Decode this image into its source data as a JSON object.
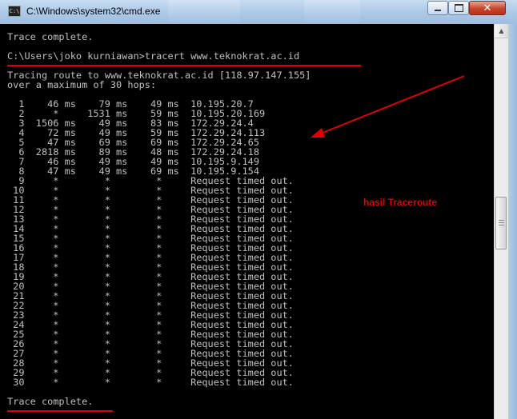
{
  "window": {
    "title": "C:\\Windows\\system32\\cmd.exe",
    "icon": "cmd-icon",
    "controls": {
      "minimize": "minimize-icon",
      "maximize": "maximize-icon",
      "close": "close-icon"
    }
  },
  "console": {
    "lines": [
      "Trace complete.",
      "",
      "C:\\Users\\joko kurniawan>tracert www.teknokrat.ac.id",
      "",
      "Tracing route to www.teknokrat.ac.id [118.97.147.155]",
      "over a maximum of 30 hops:",
      "",
      "  1    46 ms    79 ms    49 ms  10.195.20.7",
      "  2     *     1531 ms    59 ms  10.195.20.169",
      "  3  1506 ms    49 ms    83 ms  172.29.24.4",
      "  4    72 ms    49 ms    59 ms  172.29.24.113",
      "  5    47 ms    69 ms    69 ms  172.29.24.65",
      "  6  2818 ms    89 ms    48 ms  172.29.24.18",
      "  7    46 ms    49 ms    49 ms  10.195.9.149",
      "  8    47 ms    49 ms    69 ms  10.195.9.154",
      "  9     *        *        *     Request timed out.",
      " 10     *        *        *     Request timed out.",
      " 11     *        *        *     Request timed out.",
      " 12     *        *        *     Request timed out.",
      " 13     *        *        *     Request timed out.",
      " 14     *        *        *     Request timed out.",
      " 15     *        *        *     Request timed out.",
      " 16     *        *        *     Request timed out.",
      " 17     *        *        *     Request timed out.",
      " 18     *        *        *     Request timed out.",
      " 19     *        *        *     Request timed out.",
      " 20     *        *        *     Request timed out.",
      " 21     *        *        *     Request timed out.",
      " 22     *        *        *     Request timed out.",
      " 23     *        *        *     Request timed out.",
      " 24     *        *        *     Request timed out.",
      " 25     *        *        *     Request timed out.",
      " 26     *        *        *     Request timed out.",
      " 27     *        *        *     Request timed out.",
      " 28     *        *        *     Request timed out.",
      " 29     *        *        *     Request timed out.",
      " 30     *        *        *     Request timed out.",
      "",
      "Trace complete."
    ]
  },
  "annotation": {
    "label": "hasil Traceroute",
    "color": "#e00000"
  },
  "colors": {
    "console_bg": "#000000",
    "console_fg": "#c0c0c0",
    "accent": "#e00000"
  }
}
